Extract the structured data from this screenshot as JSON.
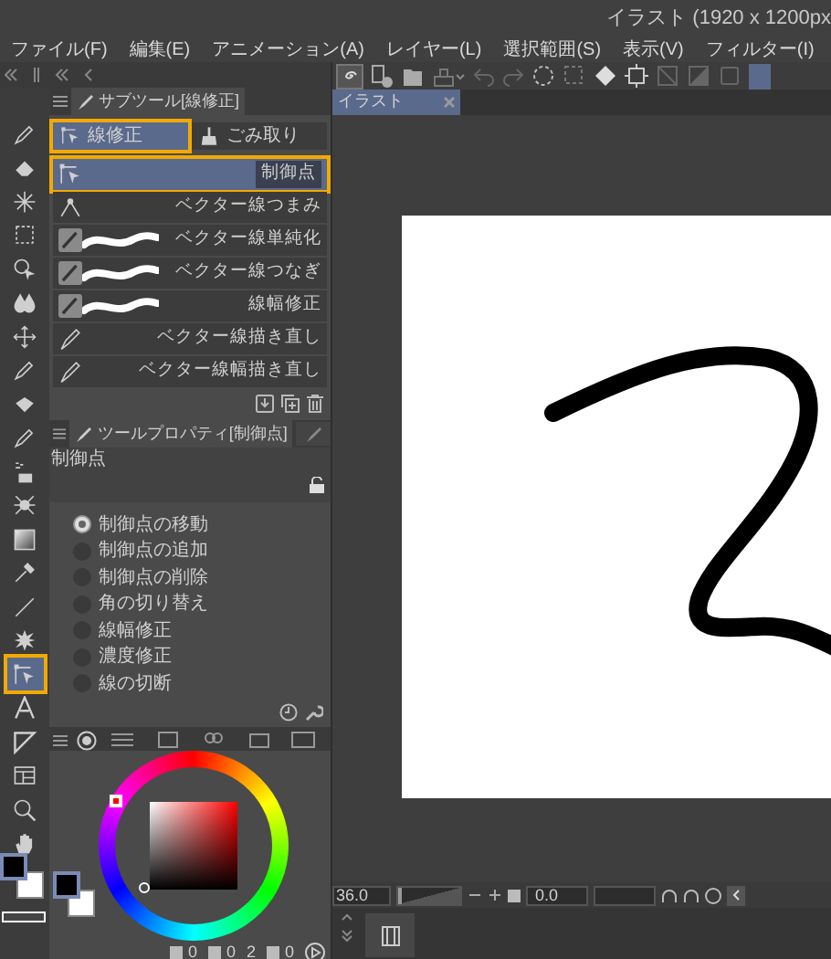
{
  "window": {
    "title": "イラスト (1920 x 1200px"
  },
  "menu": [
    "ファイル(F)",
    "編集(E)",
    "アニメーション(A)",
    "レイヤー(L)",
    "選択範囲(S)",
    "表示(V)",
    "フィルター(I)"
  ],
  "tools": [
    {
      "kind": "pen",
      "selected": false,
      "highlighted": false
    },
    {
      "kind": "eraser",
      "selected": false,
      "highlighted": false
    },
    {
      "kind": "wand",
      "selected": false,
      "highlighted": false
    },
    {
      "kind": "marquee",
      "selected": false,
      "highlighted": false
    },
    {
      "kind": "object",
      "selected": false,
      "highlighted": false
    },
    {
      "kind": "blend",
      "selected": false,
      "highlighted": false
    },
    {
      "kind": "move",
      "selected": false,
      "highlighted": false
    },
    {
      "kind": "pen",
      "selected": false,
      "highlighted": false
    },
    {
      "kind": "fill",
      "selected": false,
      "highlighted": false
    },
    {
      "kind": "pen",
      "selected": false,
      "highlighted": false
    },
    {
      "kind": "airbrush",
      "selected": false,
      "highlighted": false
    },
    {
      "kind": "decoration",
      "selected": false,
      "highlighted": false
    },
    {
      "kind": "gradient",
      "selected": false,
      "highlighted": false
    },
    {
      "kind": "eyedropper",
      "selected": false,
      "highlighted": false
    },
    {
      "kind": "line",
      "selected": false,
      "highlighted": false
    },
    {
      "kind": "burst",
      "selected": false,
      "highlighted": false
    },
    {
      "kind": "control",
      "selected": true,
      "highlighted": true
    },
    {
      "kind": "text",
      "selected": false,
      "highlighted": false
    },
    {
      "kind": "frame",
      "selected": false,
      "highlighted": false
    },
    {
      "kind": "layout",
      "selected": false,
      "highlighted": false
    },
    {
      "kind": "zoom",
      "selected": false,
      "highlighted": false
    },
    {
      "kind": "hand",
      "selected": false,
      "highlighted": false
    }
  ],
  "subtool_panel": {
    "title": "サブツール[線修正]",
    "groups": [
      {
        "label": "線修正",
        "selected": true,
        "highlighted": true
      },
      {
        "label": "ごみ取り",
        "selected": false,
        "highlighted": false
      }
    ],
    "items": [
      {
        "label": "制御点",
        "kind": "control",
        "selected": true,
        "highlighted": true
      },
      {
        "label": "ベクター線つまみ",
        "kind": "pinch",
        "selected": false,
        "highlighted": false
      },
      {
        "label": "ベクター線単純化",
        "kind": "stroke",
        "selected": false,
        "highlighted": false
      },
      {
        "label": "ベクター線つなぎ",
        "kind": "stroke",
        "selected": false,
        "highlighted": false
      },
      {
        "label": "線幅修正",
        "kind": "stroke",
        "selected": false,
        "highlighted": false
      },
      {
        "label": "ベクター線描き直し",
        "kind": "redraw",
        "selected": false,
        "highlighted": false
      },
      {
        "label": "ベクター線幅描き直し",
        "kind": "redraw",
        "selected": false,
        "highlighted": false
      }
    ]
  },
  "tool_property": {
    "title": "ツールプロパティ[制御点]",
    "label": "制御点",
    "modes": [
      {
        "label": "制御点の移動",
        "selected": true
      },
      {
        "label": "制御点の追加",
        "selected": false
      },
      {
        "label": "制御点の削除",
        "selected": false
      },
      {
        "label": "角の切り替え",
        "selected": false
      },
      {
        "label": "線幅修正",
        "selected": false
      },
      {
        "label": "濃度修正",
        "selected": false
      },
      {
        "label": "線の切断",
        "selected": false
      }
    ]
  },
  "color_panel": {
    "values": [
      "0",
      "0",
      "2",
      "0"
    ]
  },
  "canvas_tab": {
    "title": "イラスト",
    "selected": true
  },
  "navigator": {
    "zoom": "36.0",
    "zoom_slider": {
      "level": 0.03
    },
    "rotation": "0.0"
  }
}
